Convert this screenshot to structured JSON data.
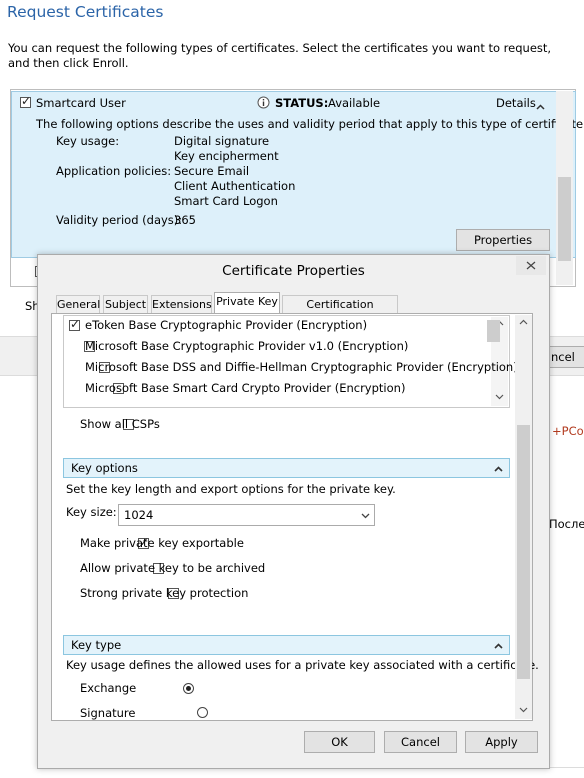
{
  "page": {
    "title": "Request Certificates",
    "intro": "You can request the following types of certificates. Select the certificates you want to request, and then click Enroll."
  },
  "certificate": {
    "name": "Smartcard User",
    "checked": true,
    "status_label": "STATUS:",
    "status_value": "Available",
    "details_label": "Details",
    "description": "The following options describe the uses and validity period that apply to this type of certificate:",
    "key_usage_label": "Key usage:",
    "key_usage_values": [
      "Digital signature",
      "Key encipherment"
    ],
    "app_policies_label": "Application policies:",
    "app_policies_values": [
      "Secure Email",
      "Client Authentication",
      "Smart Card Logon"
    ],
    "validity_label": "Validity period (days):",
    "validity_value": "365",
    "properties_button": "Properties"
  },
  "background": {
    "show_partial": "Sh",
    "cancel_partial": "ncel",
    "pcol_partial": "+PCol",
    "russian_partial": "После"
  },
  "dialog": {
    "title": "Certificate Properties",
    "tabs": [
      "General",
      "Subject",
      "Extensions",
      "Private Key",
      "Certification Authority"
    ],
    "active_tab": "Private Key",
    "csp_list": [
      {
        "label": "eToken Base Cryptographic Provider (Encryption)",
        "checked": true
      },
      {
        "label": "Microsoft Base Cryptographic Provider v1.0 (Encryption)",
        "checked": false
      },
      {
        "label": "Microsoft Base DSS and Diffie-Hellman Cryptographic Provider (Encryption)",
        "checked": false
      },
      {
        "label": "Microsoft Base Smart Card Crypto Provider (Encryption)",
        "checked": false
      }
    ],
    "show_all_csps": "Show all CSPs",
    "key_options": {
      "title": "Key options",
      "description": "Set the key length and export options for the private key.",
      "key_size_label": "Key size:",
      "key_size_value": "1024",
      "options": [
        {
          "label": "Make private key exportable",
          "checked": true
        },
        {
          "label": "Allow private key to be archived",
          "checked": false
        },
        {
          "label": "Strong private key protection",
          "checked": false
        }
      ]
    },
    "key_type": {
      "title": "Key type",
      "description": "Key usage defines the allowed uses for a private key associated with a certificate.",
      "exchange": "Exchange",
      "signature": "Signature",
      "selected": "Exchange"
    },
    "buttons": {
      "ok": "OK",
      "cancel": "Cancel",
      "apply": "Apply"
    }
  }
}
